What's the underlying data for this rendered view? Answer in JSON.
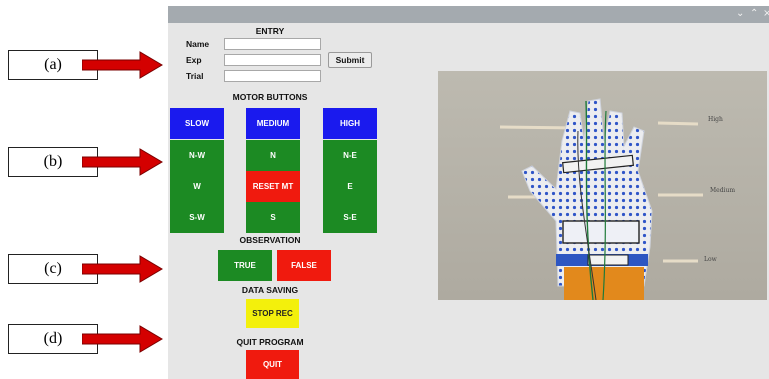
{
  "annotations": [
    {
      "label": "(a)"
    },
    {
      "label": "(b)"
    },
    {
      "label": "(c)"
    },
    {
      "label": "(d)"
    }
  ],
  "colors": {
    "arrow": "#d40000",
    "blue": "#1a1aee",
    "green": "#1c8a23",
    "red": "#f01a0e",
    "yellow": "#f3f00c",
    "titlebar": "#a4aaaf"
  },
  "window": {
    "titlebar_icons": [
      "chevron-down-icon",
      "chevron-up-icon",
      "close-icon"
    ],
    "entry": {
      "title": "ENTRY",
      "fields": [
        {
          "label": "Name",
          "value": ""
        },
        {
          "label": "Exp",
          "value": ""
        },
        {
          "label": "Trial",
          "value": ""
        }
      ],
      "submit_label": "Submit"
    },
    "motor": {
      "title": "MOTOR BUTTONS",
      "buttons": [
        {
          "label": "SLOW",
          "color": "blue"
        },
        {
          "label": "MEDIUM",
          "color": "blue"
        },
        {
          "label": "HIGH",
          "color": "blue"
        },
        {
          "label": "N-W",
          "color": "green"
        },
        {
          "label": "N",
          "color": "green"
        },
        {
          "label": "N-E",
          "color": "green"
        },
        {
          "label": "W",
          "color": "green"
        },
        {
          "label": "RESET MT",
          "color": "red"
        },
        {
          "label": "E",
          "color": "green"
        },
        {
          "label": "S-W",
          "color": "green"
        },
        {
          "label": "S",
          "color": "green"
        },
        {
          "label": "S-E",
          "color": "green"
        }
      ]
    },
    "observation": {
      "title": "OBSERVATION",
      "true_label": "TRUE",
      "false_label": "FALSE"
    },
    "data_saving": {
      "title": "DATA SAVING",
      "stop_label": "STOP REC"
    },
    "quit": {
      "title": "QUIT PROGRAM",
      "quit_label": "QUIT"
    },
    "camera": {
      "labels": [
        "High",
        "Medium",
        "Low"
      ]
    }
  }
}
